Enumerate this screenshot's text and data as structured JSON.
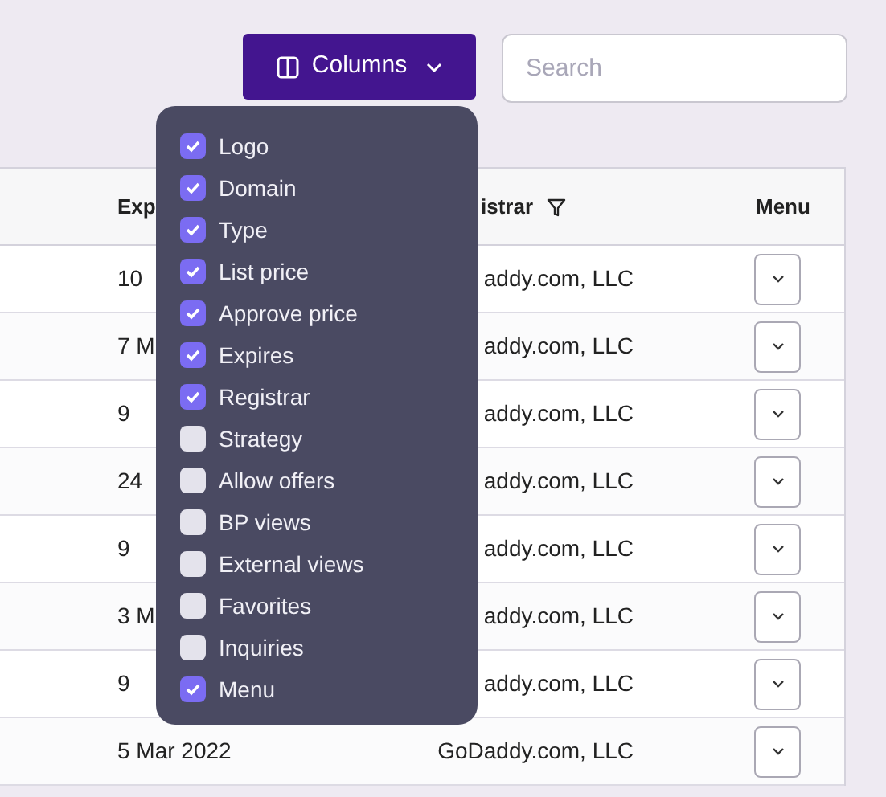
{
  "toolbar": {
    "columns_button": "Columns",
    "search": {
      "placeholder": "Search"
    }
  },
  "table": {
    "columns": [
      {
        "label": "Exp"
      },
      {
        "label": "istrar",
        "filter": true
      },
      {
        "label": "Menu",
        "filter": false
      }
    ],
    "rows": [
      {
        "expires": "10",
        "registrar": "addy.com, LLC"
      },
      {
        "expires": "7 M",
        "registrar": "addy.com, LLC"
      },
      {
        "expires": "9",
        "registrar": "addy.com, LLC"
      },
      {
        "expires": "24",
        "registrar": "addy.com, LLC"
      },
      {
        "expires": "9",
        "registrar": "addy.com, LLC"
      },
      {
        "expires": "3 M",
        "registrar": "addy.com, LLC"
      },
      {
        "expires": "9",
        "registrar": "addy.com, LLC"
      },
      {
        "expires": "5 Mar 2022",
        "registrar": "GoDaddy.com, LLC"
      }
    ]
  },
  "columns_menu": {
    "items": [
      {
        "label": "Logo",
        "checked": true
      },
      {
        "label": "Domain",
        "checked": true
      },
      {
        "label": "Type",
        "checked": true
      },
      {
        "label": "List price",
        "checked": true
      },
      {
        "label": "Approve price",
        "checked": true
      },
      {
        "label": "Expires",
        "checked": true
      },
      {
        "label": "Registrar",
        "checked": true
      },
      {
        "label": "Strategy",
        "checked": false
      },
      {
        "label": "Allow offers",
        "checked": false
      },
      {
        "label": "BP views",
        "checked": false
      },
      {
        "label": "External views",
        "checked": false
      },
      {
        "label": "Favorites",
        "checked": false
      },
      {
        "label": "Inquiries",
        "checked": false
      },
      {
        "label": "Menu",
        "checked": true
      }
    ]
  }
}
